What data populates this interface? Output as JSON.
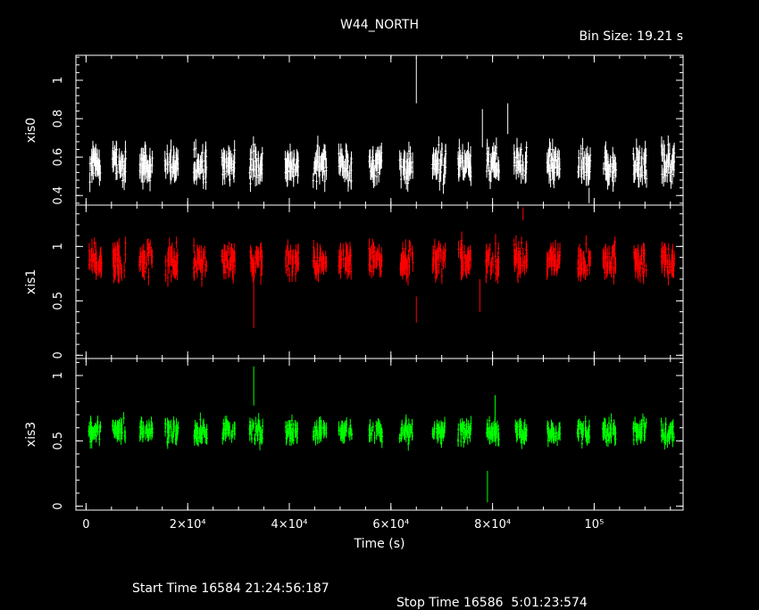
{
  "header": {
    "title": "W44_NORTH",
    "bin_size": "Bin Size: 19.21 s"
  },
  "footer": {
    "start_time": "Start Time 16584 21:24:56:187",
    "stop_time": "Stop Time 16586  5:01:23:574"
  },
  "chart_data": {
    "type": "scatter",
    "title": "W44_NORTH",
    "xlabel": "Time (s)",
    "xlim": [
      -2000,
      117500
    ],
    "x_ticks": [
      {
        "value": 0,
        "label": "0"
      },
      {
        "value": 20000,
        "label": "2×10⁴"
      },
      {
        "value": 40000,
        "label": "4×10⁴"
      },
      {
        "value": 60000,
        "label": "6×10⁴"
      },
      {
        "value": 80000,
        "label": "8×10⁴"
      },
      {
        "value": 100000,
        "label": "10⁵"
      }
    ],
    "segment_centers": [
      1800,
      6500,
      11800,
      16800,
      22500,
      28000,
      33500,
      40500,
      46000,
      51000,
      57000,
      63000,
      69500,
      74500,
      80000,
      85500,
      92000,
      98000,
      103000,
      109000,
      114500
    ],
    "panels": [
      {
        "name": "xis0",
        "ylabel": "xis0",
        "color": "#ffffff",
        "ylim": [
          0.35,
          1.13
        ],
        "y_ticks": [
          {
            "value": 0.4,
            "label": "0.4"
          },
          {
            "value": 0.6,
            "label": "0.6"
          },
          {
            "value": 0.8,
            "label": "0.8"
          },
          {
            "value": 1,
            "label": "1"
          }
        ],
        "mean": 0.56,
        "scatter": 0.06,
        "error": 0.045,
        "spikes": [
          {
            "x": 65000,
            "y": 1.0,
            "err": 0.12
          },
          {
            "x": 78000,
            "y": 0.75,
            "err": 0.1
          },
          {
            "x": 83000,
            "y": 0.8,
            "err": 0.08
          },
          {
            "x": 99000,
            "y": 0.4,
            "err": 0.04
          }
        ]
      },
      {
        "name": "xis1",
        "ylabel": "xis1",
        "color": "#ff0000",
        "ylim": [
          -0.03,
          1.38
        ],
        "y_ticks": [
          {
            "value": 0,
            "label": "0"
          },
          {
            "value": 0.5,
            "label": "0.5"
          },
          {
            "value": 1,
            "label": "1"
          }
        ],
        "mean": 0.87,
        "scatter": 0.1,
        "error": 0.07,
        "spikes": [
          {
            "x": 33000,
            "y": 0.5,
            "err": 0.25
          },
          {
            "x": 65000,
            "y": 0.42,
            "err": 0.12
          },
          {
            "x": 77500,
            "y": 0.55,
            "err": 0.15
          },
          {
            "x": 86000,
            "y": 1.3,
            "err": 0.06
          }
        ]
      },
      {
        "name": "xis3",
        "ylabel": "xis3",
        "color": "#00ff00",
        "ylim": [
          -0.03,
          1.13
        ],
        "y_ticks": [
          {
            "value": 0,
            "label": "0"
          },
          {
            "value": 0.5,
            "label": "0.5"
          },
          {
            "value": 1,
            "label": "1"
          }
        ],
        "mean": 0.57,
        "scatter": 0.055,
        "error": 0.045,
        "spikes": [
          {
            "x": 33000,
            "y": 0.92,
            "err": 0.15
          },
          {
            "x": 79000,
            "y": 0.15,
            "err": 0.12
          },
          {
            "x": 80500,
            "y": 0.7,
            "err": 0.15
          }
        ]
      }
    ]
  }
}
